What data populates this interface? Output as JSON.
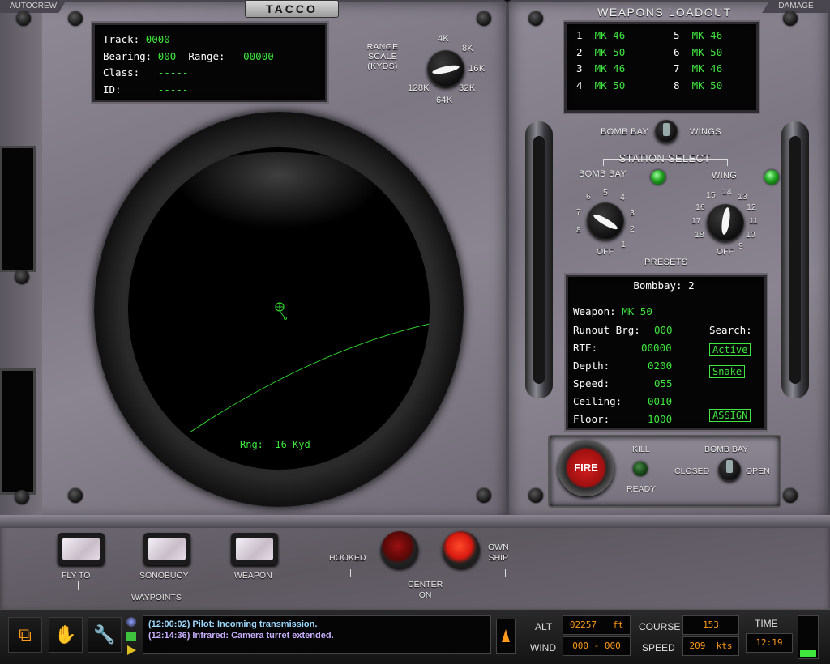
{
  "corners": {
    "left_tab": "AUTOCREW",
    "right_tab": "DAMAGE"
  },
  "tacco": {
    "title": "TACCO",
    "track_label": "Track:",
    "track_value": "0000",
    "bearing_label": "Bearing:",
    "bearing_value": "000",
    "range_label": "Range:",
    "range_value": "00000",
    "class_label": "Class:",
    "class_value": "-----",
    "id_label": "ID:",
    "id_value": "-----",
    "range_scale_label": "RANGE\nSCALE\n(KYDS)",
    "range_scale_ticks": [
      "4K",
      "8K",
      "16K",
      "32K",
      "64K",
      "128K"
    ],
    "range_scale_selected": "16K",
    "scope_readout": "Rng:  16 Kyd"
  },
  "weapons_loadout": {
    "title": "WEAPONS LOADOUT",
    "stations": [
      {
        "n": "1",
        "w": "MK 46"
      },
      {
        "n": "2",
        "w": "MK 50"
      },
      {
        "n": "3",
        "w": "MK 46"
      },
      {
        "n": "4",
        "w": "MK 50"
      },
      {
        "n": "5",
        "w": "MK 46"
      },
      {
        "n": "6",
        "w": "MK 50"
      },
      {
        "n": "7",
        "w": "MK 46"
      },
      {
        "n": "8",
        "w": "MK 50"
      }
    ],
    "bomb_bay_label": "BOMB BAY",
    "wings_label": "WINGS",
    "station_select": "STATION SELECT",
    "station_bomb_bay": "BOMB BAY",
    "station_wing": "WING",
    "bay_ticks": [
      "1",
      "2",
      "3",
      "4",
      "5",
      "6",
      "7",
      "8"
    ],
    "wing_ticks": [
      "9",
      "10",
      "11",
      "12",
      "13",
      "14",
      "15",
      "16",
      "17",
      "18"
    ],
    "off_label": "OFF",
    "presets_label": "PRESETS"
  },
  "bombbay": {
    "header": "Bombbay: 2",
    "weapon_label": "Weapon:",
    "weapon_value": "MK 50",
    "runout_label": "Runout Brg:",
    "runout_value": "000",
    "rte_label": "RTE:",
    "rte_value": "00000",
    "depth_label": "Depth:",
    "depth_value": "0200",
    "speed_label": "Speed:",
    "speed_value": "055",
    "ceiling_label": "Ceiling:",
    "ceiling_value": "0010",
    "floor_label": "Floor:",
    "floor_value": "1000",
    "search_label": "Search:",
    "active_btn": "Active",
    "snake_btn": "Snake",
    "assign_btn": "ASSIGN"
  },
  "fire_panel": {
    "fire": "FIRE",
    "kill": "KILL",
    "ready": "READY",
    "bomb_bay": "BOMB BAY",
    "closed": "CLOSED",
    "open": "OPEN"
  },
  "waypoints": {
    "fly_to": "FLY TO",
    "sonobuoy": "SONOBUOY",
    "weapon": "WEAPON",
    "group": "WAYPOINTS",
    "hooked": "HOOKED",
    "own_ship": "OWN\nSHIP",
    "center_on": "CENTER\nON"
  },
  "status_bar": {
    "messages": [
      {
        "time": "(12:00:02)",
        "text": " Pilot: Incoming transmission.",
        "color": "#9dd8ff"
      },
      {
        "time": "(12:14:36)",
        "text": " Infrared: Camera turret extended.",
        "color": "#c9b0ff"
      }
    ],
    "alt_label": "ALT",
    "alt_value": "02257   ft",
    "wind_label": "WIND",
    "wind_value": "000 - 000",
    "course_label": "COURSE",
    "course_value": "153",
    "speed_label": "SPEED",
    "speed_value": "209  kts",
    "time_label": "TIME",
    "time_value": "12:19"
  }
}
